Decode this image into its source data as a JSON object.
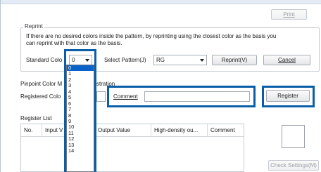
{
  "toolbar": {
    "print_label": "Print"
  },
  "reprint": {
    "title": "Reprint",
    "desc_line1": "If there are no desired colors inside the pattern, by reprinting using the closest color as the basis you",
    "desc_line2": "can reprint with that color as the basis.",
    "standard_color_label": "Standard Colo",
    "standard_color_value": "0",
    "select_pattern_label": "Select Pattern(J)",
    "select_pattern_value": "RG",
    "reprint_button": "Reprint(V)",
    "cancel_button": "Cancel"
  },
  "pinpoint": {
    "title_prefix": "Pinpoint Color M",
    "title_suffix": "stration",
    "registered_label": "Registered Colo",
    "registered_value": "",
    "comment_label": "Comment",
    "comment_value": "",
    "register_button": "Register"
  },
  "register_list": {
    "title": "Register List",
    "columns": [
      "No.",
      "Input V",
      "Output Value",
      "High-density ou...",
      "Comment"
    ],
    "check_settings_button": "Check Settings(M)"
  },
  "dropdown": {
    "options": [
      "0",
      "1",
      "2",
      "3",
      "4",
      "5",
      "6",
      "7",
      "8",
      "9",
      "10",
      "11",
      "12",
      "13",
      "14"
    ],
    "selected": "0"
  },
  "colors": {
    "highlight": "#0a5ea8",
    "selection": "#0a63c9"
  }
}
